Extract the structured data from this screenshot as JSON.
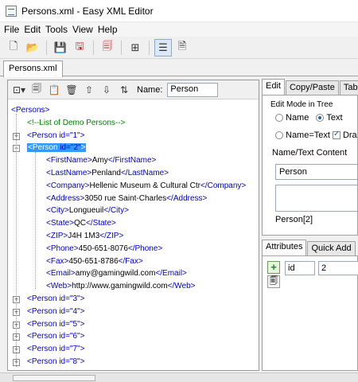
{
  "window": {
    "title": "Persons.xml - Easy XML Editor"
  },
  "menu": [
    "File",
    "Edit",
    "Tools",
    "View",
    "Help"
  ],
  "main_toolbar": {
    "icons": [
      "new-file-icon",
      "open-folder-icon",
      "save-icon",
      "save-all-icon",
      "export-icon",
      "tree-view-icon",
      "tree-layout-icon",
      "text-view-icon"
    ]
  },
  "doc_tab": "Persons.xml",
  "tree_toolbar": {
    "name_label": "Name:",
    "name_value": "Person"
  },
  "tree": [
    {
      "kind": "element",
      "open": "<Persons>"
    },
    {
      "kind": "comment",
      "text": "<!--List of Demo Persons-->"
    },
    {
      "kind": "element",
      "open": "<Person ",
      "attr": "id=\"1\"",
      "close": ">"
    },
    {
      "kind": "element",
      "open": "<Person ",
      "attr": "id=\"2\"",
      "close": ">"
    },
    {
      "kind": "leaf",
      "open": "<FirstName>",
      "text": "Amy",
      "end": "</FirstName>"
    },
    {
      "kind": "leaf",
      "open": "<LastName>",
      "text": "Penland",
      "end": "</LastName>"
    },
    {
      "kind": "leaf",
      "open": "<Company>",
      "text": "Hellenic Museum & Cultural Ctr",
      "end": "</Company>"
    },
    {
      "kind": "leaf",
      "open": "<Address>",
      "text": "3050 rue Saint-Charles",
      "end": "</Address>"
    },
    {
      "kind": "leaf",
      "open": "<City>",
      "text": "Longueuil",
      "end": "</City>"
    },
    {
      "kind": "leaf",
      "open": "<State>",
      "text": "QC",
      "end": "</State>"
    },
    {
      "kind": "leaf",
      "open": "<ZIP>",
      "text": "J4H 1M3",
      "end": "</ZIP>"
    },
    {
      "kind": "leaf",
      "open": "<Phone>",
      "text": "450-651-8076",
      "end": "</Phone>"
    },
    {
      "kind": "leaf",
      "open": "<Fax>",
      "text": "450-651-8786",
      "end": "</Fax>"
    },
    {
      "kind": "leaf",
      "open": "<Email>",
      "text": "amy@gamingwild.com",
      "end": "</Email>"
    },
    {
      "kind": "leaf",
      "open": "<Web>",
      "text": "http://www.gamingwild.com",
      "end": "</Web>"
    },
    {
      "kind": "element",
      "open": "<Person ",
      "attr": "id=\"3\"",
      "close": ">"
    },
    {
      "kind": "element",
      "open": "<Person ",
      "attr": "id=\"4\"",
      "close": ">"
    },
    {
      "kind": "element",
      "open": "<Person ",
      "attr": "id=\"5\"",
      "close": ">"
    },
    {
      "kind": "element",
      "open": "<Person ",
      "attr": "id=\"6\"",
      "close": ">"
    },
    {
      "kind": "element",
      "open": "<Person ",
      "attr": "id=\"7\"",
      "close": ">"
    },
    {
      "kind": "element",
      "open": "<Person ",
      "attr": "id=\"8\"",
      "close": ">"
    }
  ],
  "selected_node": "<Person id=\"2\">",
  "edit_tabs": [
    "Edit",
    "Copy/Paste",
    "Table"
  ],
  "edit_mode": {
    "title": "Edit Mode in Tree",
    "opt_name": "Name",
    "opt_text": "Text",
    "opt_name_text": "Name=Text",
    "opt_drag": "Drag"
  },
  "name_text_content": {
    "title": "Name/Text Content",
    "value": "Person",
    "path": "Person[2]"
  },
  "attr_tabs": [
    "Attributes",
    "Quick Add"
  ],
  "attributes": {
    "name": "id",
    "value": "2"
  }
}
